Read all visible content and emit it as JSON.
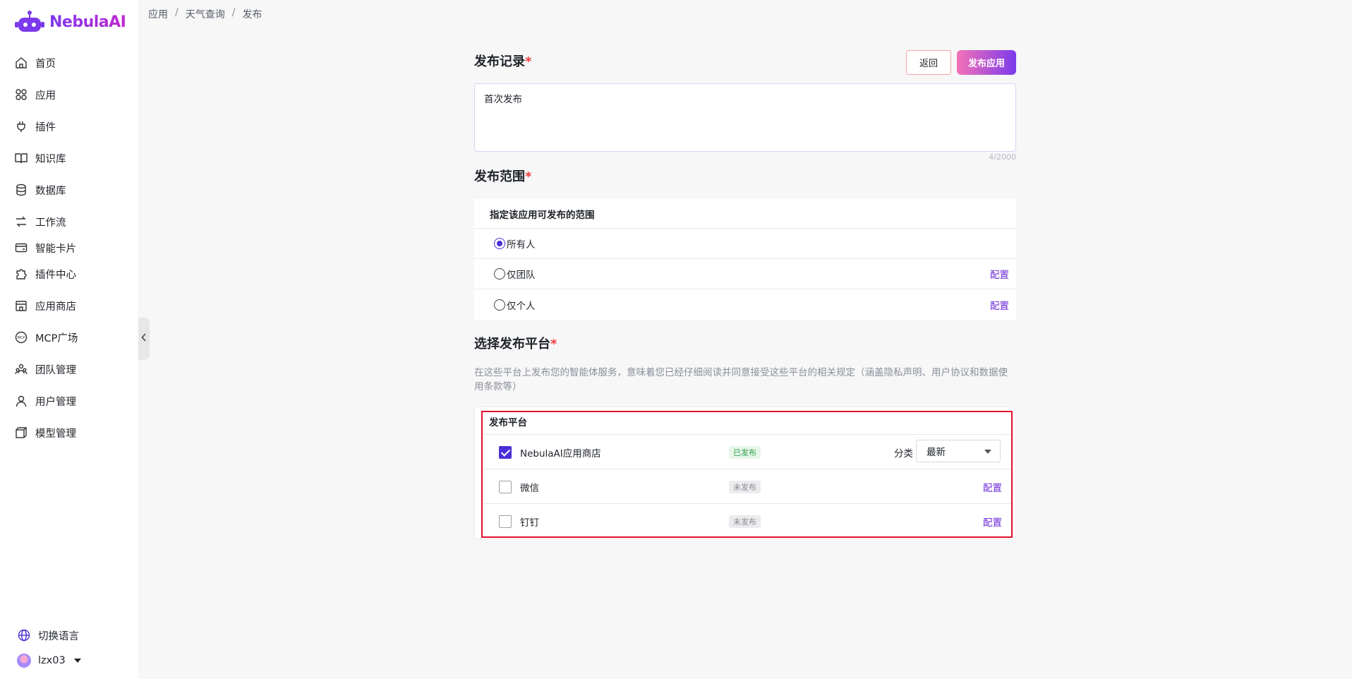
{
  "app": {
    "name": "NebulaAI"
  },
  "sidebar": {
    "items": [
      {
        "label": "首页",
        "icon": "home-icon"
      },
      {
        "label": "应用",
        "icon": "apps-icon"
      },
      {
        "label": "插件",
        "icon": "plug-icon"
      },
      {
        "label": "知识库",
        "icon": "book-icon"
      },
      {
        "label": "数据库",
        "icon": "database-icon"
      },
      {
        "label": "工作流",
        "icon": "workflow-icon"
      },
      {
        "label": "智能卡片",
        "icon": "card-icon"
      },
      {
        "label": "插件中心",
        "icon": "puzzle-icon"
      },
      {
        "label": "应用商店",
        "icon": "store-icon"
      },
      {
        "label": "MCP广场",
        "icon": "mcp-icon"
      },
      {
        "label": "团队管理",
        "icon": "team-icon"
      },
      {
        "label": "用户管理",
        "icon": "user-icon"
      },
      {
        "label": "模型管理",
        "icon": "model-icon"
      }
    ],
    "language_label": "切换语言",
    "username": "lzx03"
  },
  "breadcrumb": [
    "应用",
    "天气查询",
    "发布"
  ],
  "breadcrumb_sep": "/",
  "main": {
    "record": {
      "title": "发布记录",
      "required_mark": "*",
      "value": "首次发布",
      "counter": "4/2000"
    },
    "buttons": {
      "back": "返回",
      "publish": "发布应用"
    },
    "scope": {
      "title": "发布范围",
      "required_mark": "*",
      "header": "指定该应用可发布的范围",
      "options": [
        {
          "label": "所有人",
          "selected": true,
          "config": ""
        },
        {
          "label": "仅团队",
          "selected": false,
          "config": "配置"
        },
        {
          "label": "仅个人",
          "selected": false,
          "config": "配置"
        }
      ]
    },
    "platform": {
      "title": "选择发布平台",
      "required_mark": "*",
      "description": "在这些平台上发布您的智能体服务，意味着您已经仔细阅读并同意接受这些平台的相关规定（涵盖隐私声明、用户协议和数据使用条款等）",
      "header": "发布平台",
      "rows": [
        {
          "name": "NebulaAI应用商店",
          "checked": true,
          "status": "已发布",
          "category_label": "分类",
          "category_value": "最新"
        },
        {
          "name": "微信",
          "checked": false,
          "status": "未发布",
          "config": "配置"
        },
        {
          "name": "钉钉",
          "checked": false,
          "status": "未发布",
          "config": "配置"
        }
      ]
    }
  },
  "colors": {
    "accent": "#6d28d9",
    "highlight": "#e0112b"
  }
}
